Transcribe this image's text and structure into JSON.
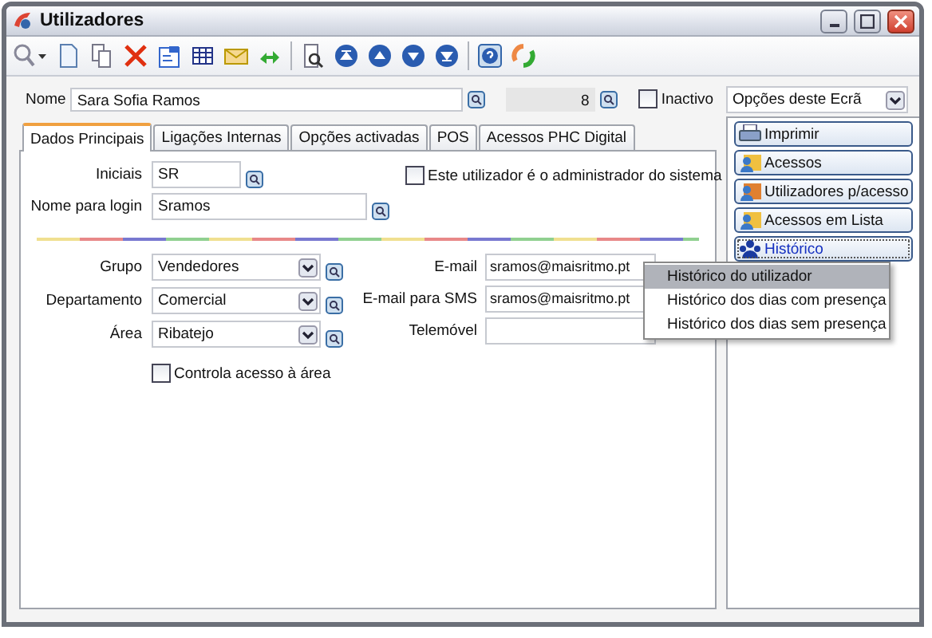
{
  "window": {
    "title": "Utilizadores"
  },
  "header": {
    "name_label": "Nome",
    "name_value": "Sara Sofia Ramos",
    "number_value": "8",
    "inactive": {
      "label": "Inactivo",
      "checked": false
    }
  },
  "tabs": [
    {
      "label": "Dados Principais",
      "selected": true
    },
    {
      "label": "Ligações Internas",
      "selected": false
    },
    {
      "label": "Opções activadas",
      "selected": false
    },
    {
      "label": "POS",
      "selected": false
    },
    {
      "label": "Acessos PHC Digital",
      "selected": false
    }
  ],
  "main": {
    "initials": {
      "label": "Iniciais",
      "value": "SR"
    },
    "login": {
      "label": "Nome para login",
      "value": "Sramos"
    },
    "admin": {
      "label": "Este utilizador é o administrador do sistema",
      "checked": false
    },
    "combos": [
      {
        "label": "Grupo",
        "value": "Vendedores"
      },
      {
        "label": "Departamento",
        "value": "Comercial"
      },
      {
        "label": "Área",
        "value": "Ribatejo"
      }
    ],
    "area_control": {
      "label": "Controla acesso à área",
      "checked": false
    },
    "contacts": [
      {
        "label": "E-mail",
        "value": "sramos@maisritmo.pt"
      },
      {
        "label": "E-mail para SMS",
        "value": "sramos@maisritmo.pt"
      },
      {
        "label": "Telemóvel"
      }
    ]
  },
  "side": {
    "options": "Opções deste Ecrã",
    "buttons": [
      {
        "label": "Imprimir",
        "kind": "print",
        "focused": false
      },
      {
        "label": "Acessos",
        "kind": "access",
        "focused": false
      },
      {
        "label": "Utilizadores p/acesso",
        "kind": "users",
        "focused": false
      },
      {
        "label": "Acessos em Lista",
        "kind": "access",
        "focused": false
      },
      {
        "label": "Histórico",
        "kind": "history",
        "focused": true
      }
    ]
  },
  "menu": [
    {
      "label": "Histórico do utilizador",
      "selected": true
    },
    {
      "label": "Histórico dos dias com presença",
      "selected": false
    },
    {
      "label": "Histórico dos dias sem presença",
      "selected": false
    }
  ]
}
